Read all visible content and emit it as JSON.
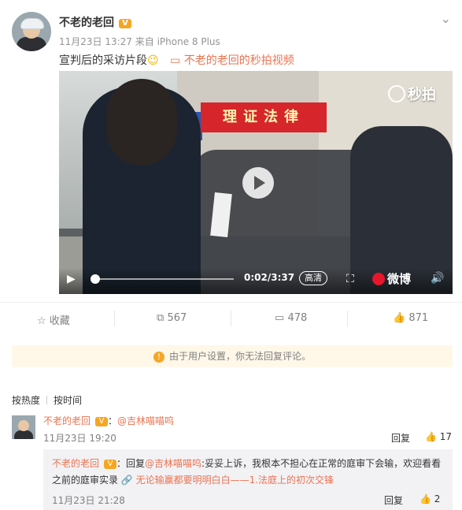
{
  "post": {
    "username": "不老的老回",
    "badge": "V",
    "meta": "11月23日 13:27 来自 iPhone 8 Plus",
    "text": "宣判后的采访片段",
    "emoji": "😉",
    "video_link": "不老的老回的秒拍视频"
  },
  "video": {
    "sign_text": "理证法律",
    "watermark": "秒拍",
    "time": "0:02/3:37",
    "quality": "高清",
    "brand": "微博",
    "progress": 0.01
  },
  "actions": {
    "favorite": "收藏",
    "repost_count": "567",
    "comment_count": "478",
    "like_count": "871"
  },
  "notice": "由于用户设置，你无法回复评论。",
  "sort": {
    "by_hot": "按热度",
    "by_time": "按时间"
  },
  "comment": {
    "name": "不老的老回",
    "colon": "：",
    "mention": "@吉林喵喵呜",
    "time": "11月23日 19:20",
    "reply_label": "回复",
    "likes": "17",
    "sub": {
      "name": "不老的老回",
      "text_a": "：回复",
      "mention": "@吉林喵喵呜",
      "text_b": ":妥妥上诉，我根本不担心在正常的庭审下会输，欢迎看看之前的庭审实录",
      "link": "无论输赢都要明明白白——1.法庭上的初次交锋",
      "time": "11月23日 21:28",
      "reply_label": "回复",
      "likes": "2"
    }
  },
  "colors": {
    "accent": "#eb7350",
    "badge": "#f5a623",
    "notice_bg": "#fff7e8"
  },
  "icons": [
    "chevron-down-icon",
    "star-icon",
    "repost-icon",
    "comment-icon",
    "like-icon",
    "info-icon",
    "link-icon",
    "play-icon",
    "fullscreen-icon",
    "volume-icon"
  ]
}
